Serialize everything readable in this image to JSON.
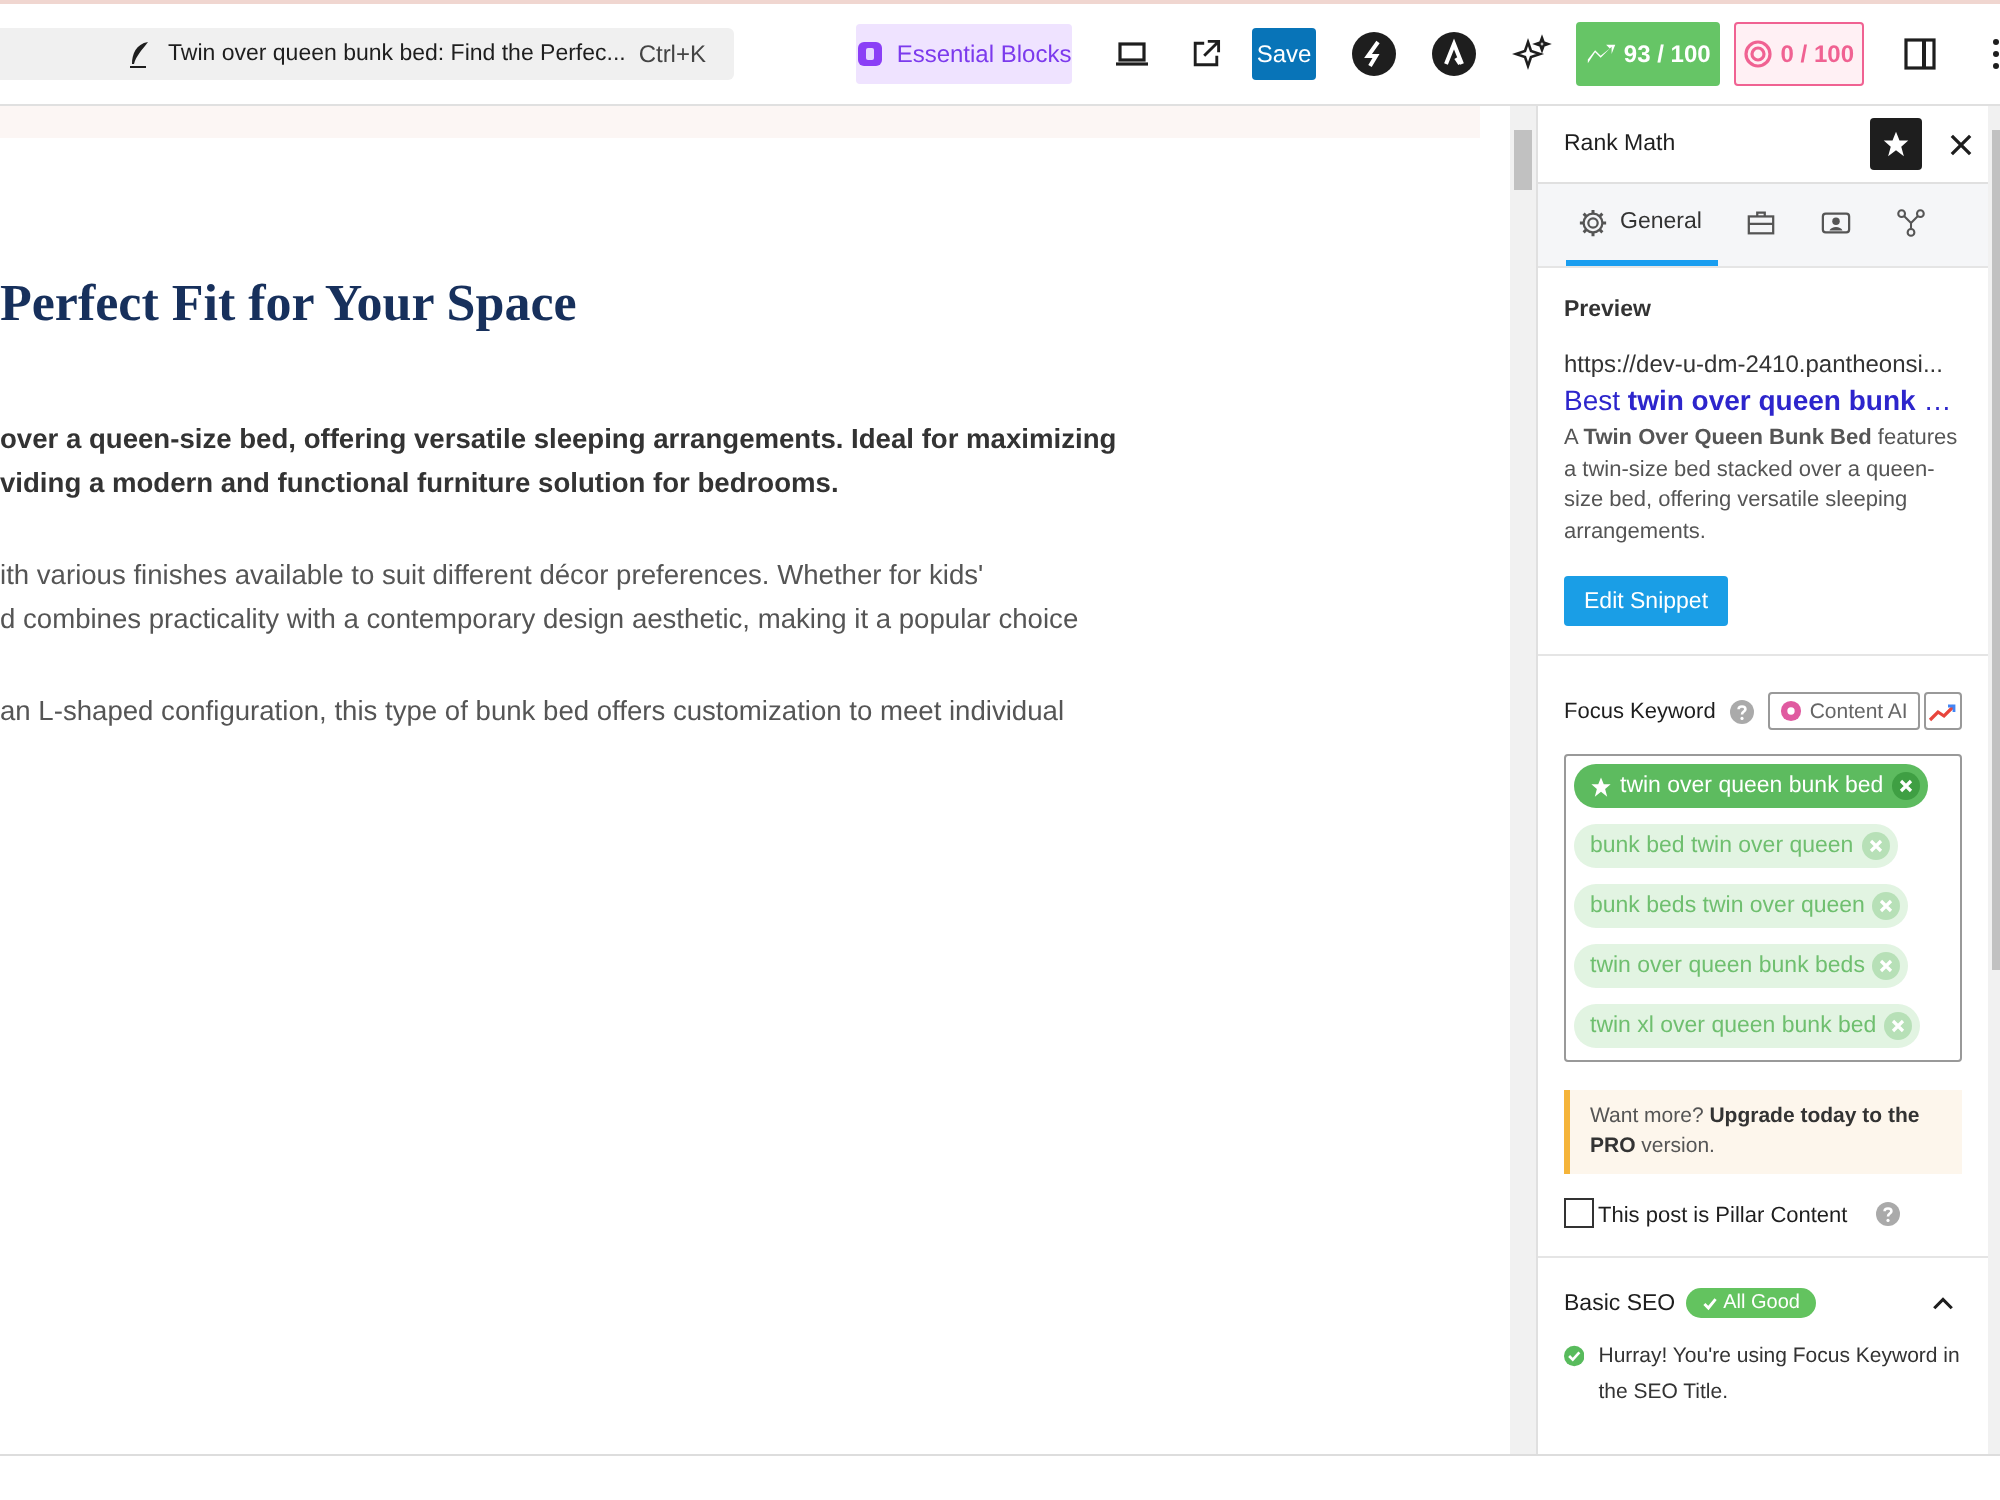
{
  "toolbar": {
    "document_title": "Twin over queen bunk bed: Find the Perfec...",
    "shortcut": "Ctrl+K",
    "blocks_button": "Essential Blocks",
    "save_button": "Save",
    "scores": [
      {
        "kind": "seo",
        "text": "93 / 100",
        "color": "#66c566"
      },
      {
        "kind": "content",
        "text": "0 / 100",
        "color": "#f06292"
      }
    ]
  },
  "editor": {
    "heading": "Perfect Fit for Your Space",
    "paragraphs": [
      {
        "kind": "lead",
        "lines": [
          "over a queen-size bed, offering versatile sleeping arrangements. Ideal for maximizing",
          "viding a modern and functional furniture solution for bedrooms."
        ]
      },
      {
        "kind": "body",
        "lines": [
          "ith various finishes available to suit different décor preferences. Whether for kids'",
          "d combines practicality with a contemporary design aesthetic, making it a popular choice"
        ]
      },
      {
        "kind": "body",
        "lines": [
          "an L-shaped configuration, this type of bunk bed offers customization to meet individual"
        ]
      }
    ]
  },
  "sidebar": {
    "title": "Rank Math",
    "tabs": [
      {
        "kind": "gear",
        "label": "General",
        "selected": true
      },
      {
        "kind": "toolbox",
        "selected": false
      },
      {
        "kind": "social",
        "selected": false
      },
      {
        "kind": "schema",
        "selected": false
      }
    ],
    "preview": {
      "heading": "Preview",
      "url": "https://dev-u-dm-2410.pantheonsi...",
      "title": "Best **twin over queen bunk** …",
      "description": "A **Twin Over Queen Bunk Bed** features a twin-size bed stacked over a queen-size bed, offering versatile sleeping arrangements.",
      "button": "Edit Snippet"
    },
    "focus_keyword": {
      "label": "Focus Keyword",
      "content_ai": "Content AI",
      "keywords": [
        {
          "text": "twin over queen bunk bed",
          "primary": true
        },
        {
          "text": "bunk bed twin over queen",
          "primary": false
        },
        {
          "text": "bunk beds twin over queen",
          "primary": false
        },
        {
          "text": "twin over queen bunk beds",
          "primary": false
        },
        {
          "text": "twin xl over queen bunk bed",
          "primary": false
        }
      ]
    },
    "notice": "Want more? **Upgrade today to the PRO** version.",
    "pillar": {
      "label": "This post is Pillar Content",
      "checked": false
    },
    "basic_seo": {
      "title": "Basic SEO",
      "badge": "All Good",
      "expanded": true,
      "checks": [
        {
          "text": "Hurray! You're using Focus Keyword in the SEO Title.",
          "passed": true
        }
      ]
    }
  }
}
